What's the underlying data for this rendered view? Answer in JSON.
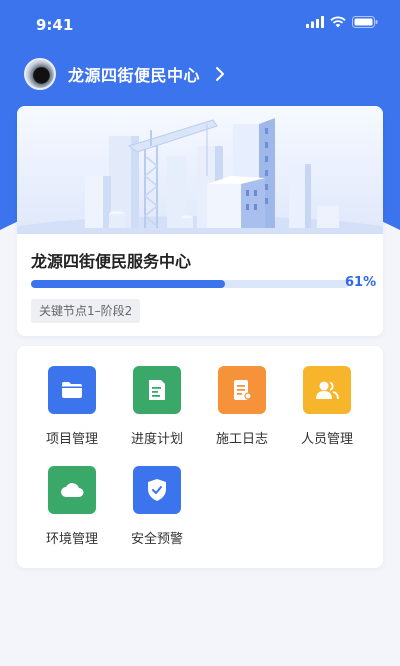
{
  "status_bar": {
    "time": "9:41"
  },
  "header": {
    "title": "龙源四街便民中心"
  },
  "project": {
    "name": "龙源四街便民服务中心",
    "progress": 0.61,
    "progress_text": "61%",
    "stage": "关键节点1–阶段2"
  },
  "menu": [
    {
      "label": "项目管理",
      "icon": "folder-icon",
      "color": "#3b74ec"
    },
    {
      "label": "进度计划",
      "icon": "document-icon",
      "color": "#3aa869"
    },
    {
      "label": "施工日志",
      "icon": "log-icon",
      "color": "#f5923a"
    },
    {
      "label": "人员管理",
      "icon": "people-icon",
      "color": "#f7b52c"
    },
    {
      "label": "环境管理",
      "icon": "cloud-icon",
      "color": "#3aa869"
    },
    {
      "label": "安全预警",
      "icon": "shield-icon",
      "color": "#3b74ec"
    }
  ],
  "colors": {
    "primary": "#3b74ec",
    "background": "#f3f5fa"
  }
}
